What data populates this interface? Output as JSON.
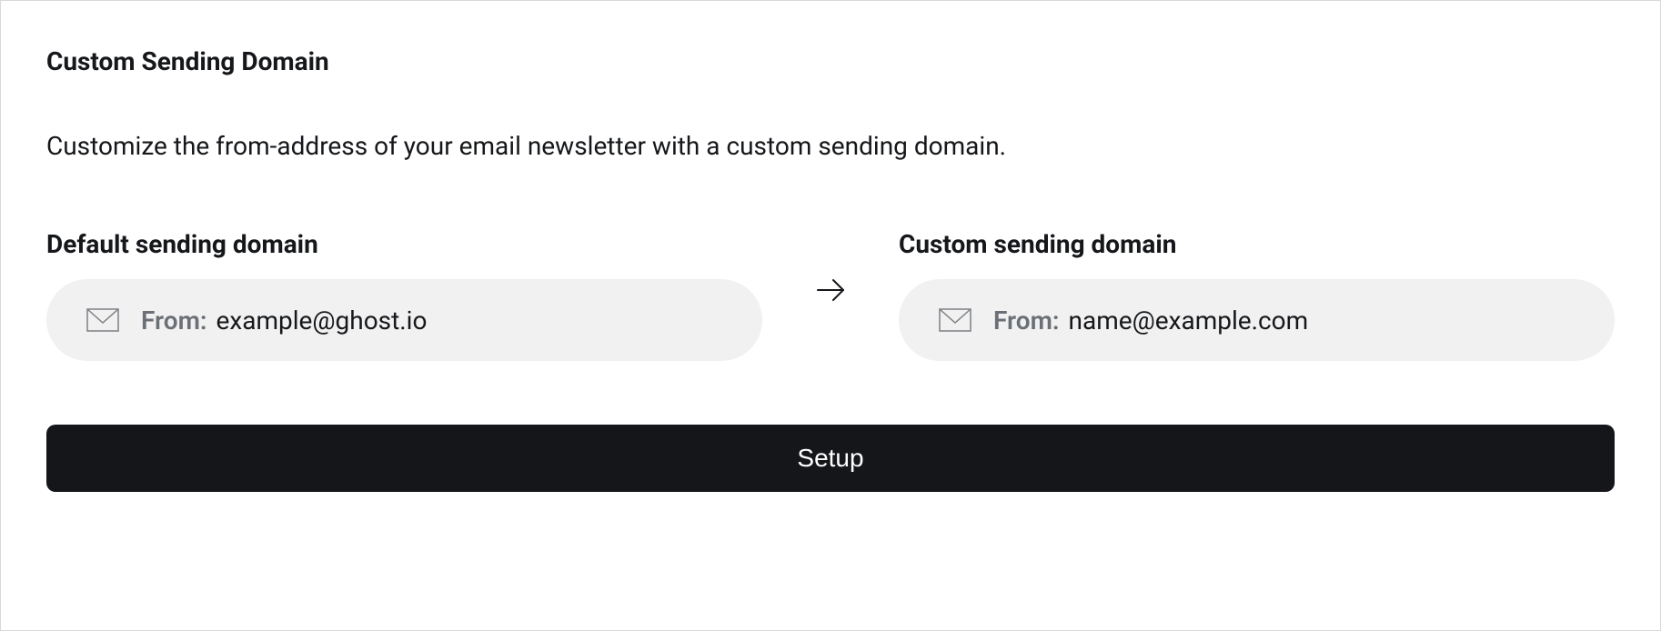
{
  "title": "Custom Sending Domain",
  "description": "Customize the from-address of your email newsletter with a custom sending domain.",
  "default_domain": {
    "label": "Default sending domain",
    "from_label": "From:",
    "from_value": "example@ghost.io"
  },
  "custom_domain": {
    "label": "Custom sending domain",
    "from_label": "From:",
    "from_value": "name@example.com"
  },
  "setup_button_label": "Setup"
}
